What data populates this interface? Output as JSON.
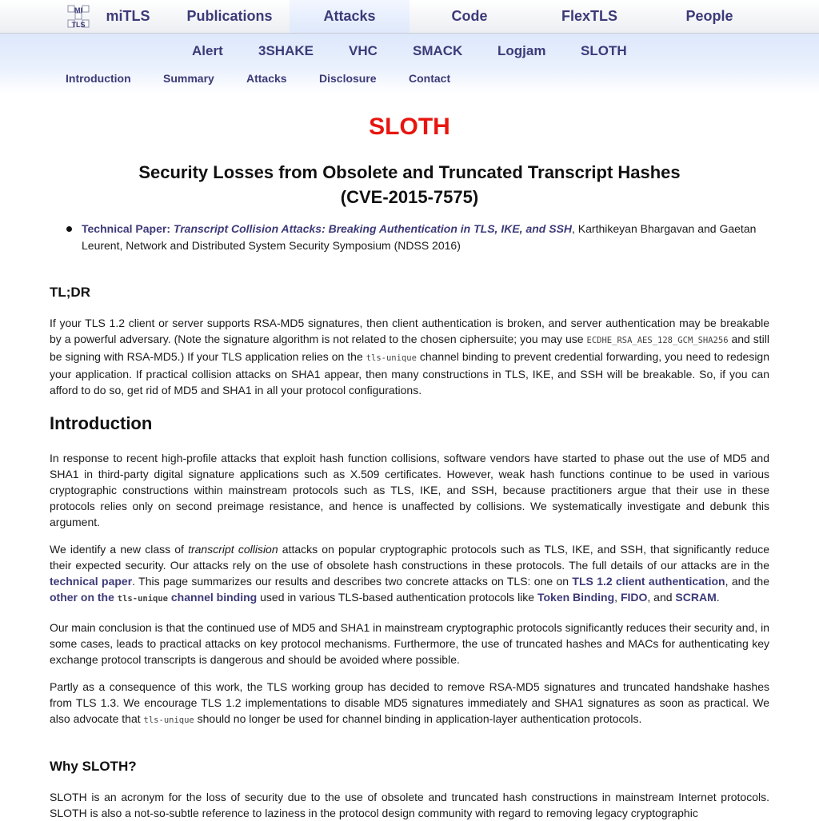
{
  "topnav": {
    "tabs": [
      {
        "label": "miTLS"
      },
      {
        "label": "Publications"
      },
      {
        "label": "Attacks"
      },
      {
        "label": "Code"
      },
      {
        "label": "FlexTLS"
      },
      {
        "label": "People"
      }
    ],
    "active_tab": "Attacks",
    "logo_letters": {
      "l1": "MI",
      "l2": "TLS"
    }
  },
  "attacks_nav": [
    {
      "label": "Alert"
    },
    {
      "label": "3SHAKE"
    },
    {
      "label": "VHC"
    },
    {
      "label": "SMACK"
    },
    {
      "label": "Logjam"
    },
    {
      "label": "SLOTH"
    }
  ],
  "page_nav": [
    {
      "label": "Introduction"
    },
    {
      "label": "Summary"
    },
    {
      "label": "Attacks"
    },
    {
      "label": "Disclosure"
    },
    {
      "label": "Contact"
    }
  ],
  "page": {
    "title": "SLOTH",
    "subtitle_line1": "Security Losses from Obsolete and Truncated Transcript Hashes",
    "subtitle_line2": "(CVE-2015-7575)"
  },
  "paper": {
    "prefix": "Technical Paper:",
    "title": "Transcript Collision Attacks: Breaking Authentication in TLS, IKE, and SSH",
    "citation": ", Karthikeyan Bhargavan and Gaetan Leurent, Network and Distributed System Security Symposium (NDSS 2016)"
  },
  "tldr": {
    "heading": "TL;DR",
    "t1": "If your TLS 1.2 client or server supports RSA-MD5 signatures, then client authentication is broken, and server authentication may be breakable by a powerful adversary. (Note the signature algorithm is not related to the chosen ciphersuite; you may use ",
    "code1": "ECDHE_RSA_AES_128_GCM_SHA256",
    "t2": " and still be signing with RSA-MD5.) If your TLS application relies on the ",
    "code2": "tls-unique",
    "t3": " channel binding to prevent credential forwarding, you need to redesign your application. If practical collision attacks on SHA1 appear, then many constructions in TLS, IKE, and SSH will be breakable. So, if you can afford to do so, get rid of MD5 and SHA1 in all your protocol configurations."
  },
  "intro": {
    "heading": "Introduction",
    "p1": "In response to recent high-profile attacks that exploit hash function collisions, software vendors have started to phase out the use of MD5 and SHA1 in third-party digital signature applications such as X.509 certificates. However, weak hash functions continue to be used in various cryptographic constructions within mainstream protocols such as TLS, IKE, and SSH, because practitioners argue that their use in these protocols relies only on second preimage resistance, and hence is unaffected by collisions. We systematically investigate and debunk this argument.",
    "p2a": "We identify a new class of ",
    "p2_em": "transcript collision",
    "p2b": " attacks on popular cryptographic protocols such as TLS, IKE, and SSH, that significantly reduce their expected security. Our attacks rely on the use of obsolete hash constructions in these protocols. The full details of our attacks are in the ",
    "link_paper": "technical paper",
    "p2c": ". This page summarizes our results and describes two concrete attacks on TLS: one on ",
    "link_client_auth": "TLS 1.2 client authentication",
    "p2d": ", and the ",
    "link_other_a": "other on the ",
    "link_other_code": "tls-unique",
    "link_other_b": " channel binding",
    "p2e": " used in various TLS-based authentication protocols like ",
    "link_token": "Token Binding",
    "sep1": ", ",
    "link_fido": "FIDO",
    "sep2": ", and ",
    "link_scram": "SCRAM",
    "end": ".",
    "p3": "Our main conclusion is that the continued use of MD5 and SHA1 in mainstream cryptographic protocols significantly reduces their security and, in some cases, leads to practical attacks on key protocol mechanisms. Furthermore, the use of truncated hashes and MACs for authenticating key exchange protocol transcripts is dangerous and should be avoided where possible.",
    "p4a": "Partly as a consequence of this work, the TLS working group has decided to remove RSA-MD5 signatures and truncated handshake hashes from TLS 1.3. We encourage TLS 1.2 implementations to disable MD5 signatures immediately and SHA1 signatures as soon as practical. We also advocate that ",
    "p4_code": "tls-unique",
    "p4b": " should no longer be used for channel binding in application-layer authentication protocols."
  },
  "why": {
    "heading": "Why SLOTH?",
    "p1": "SLOTH is an acronym for the loss of security due to the use of obsolete and truncated hash constructions in mainstream Internet protocols. SLOTH is also a not-so-subtle reference to laziness in the protocol design community with regard to removing legacy cryptographic"
  }
}
